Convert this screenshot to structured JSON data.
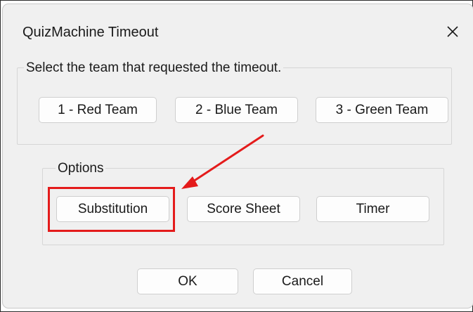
{
  "window": {
    "title": "QuizMachine Timeout"
  },
  "team_group": {
    "label": "Select the team that requested the timeout.",
    "buttons": [
      {
        "label": "1 - Red Team"
      },
      {
        "label": "2 - Blue Team"
      },
      {
        "label": "3 - Green Team"
      }
    ]
  },
  "options_group": {
    "label": "Options",
    "buttons": [
      {
        "label": "Substitution"
      },
      {
        "label": "Score Sheet"
      },
      {
        "label": "Timer"
      }
    ]
  },
  "footer": {
    "ok_label": "OK",
    "cancel_label": "Cancel"
  },
  "annotation": {
    "color": "#e41b1b",
    "target": "Substitution"
  },
  "icons": {
    "close": "close-icon"
  }
}
